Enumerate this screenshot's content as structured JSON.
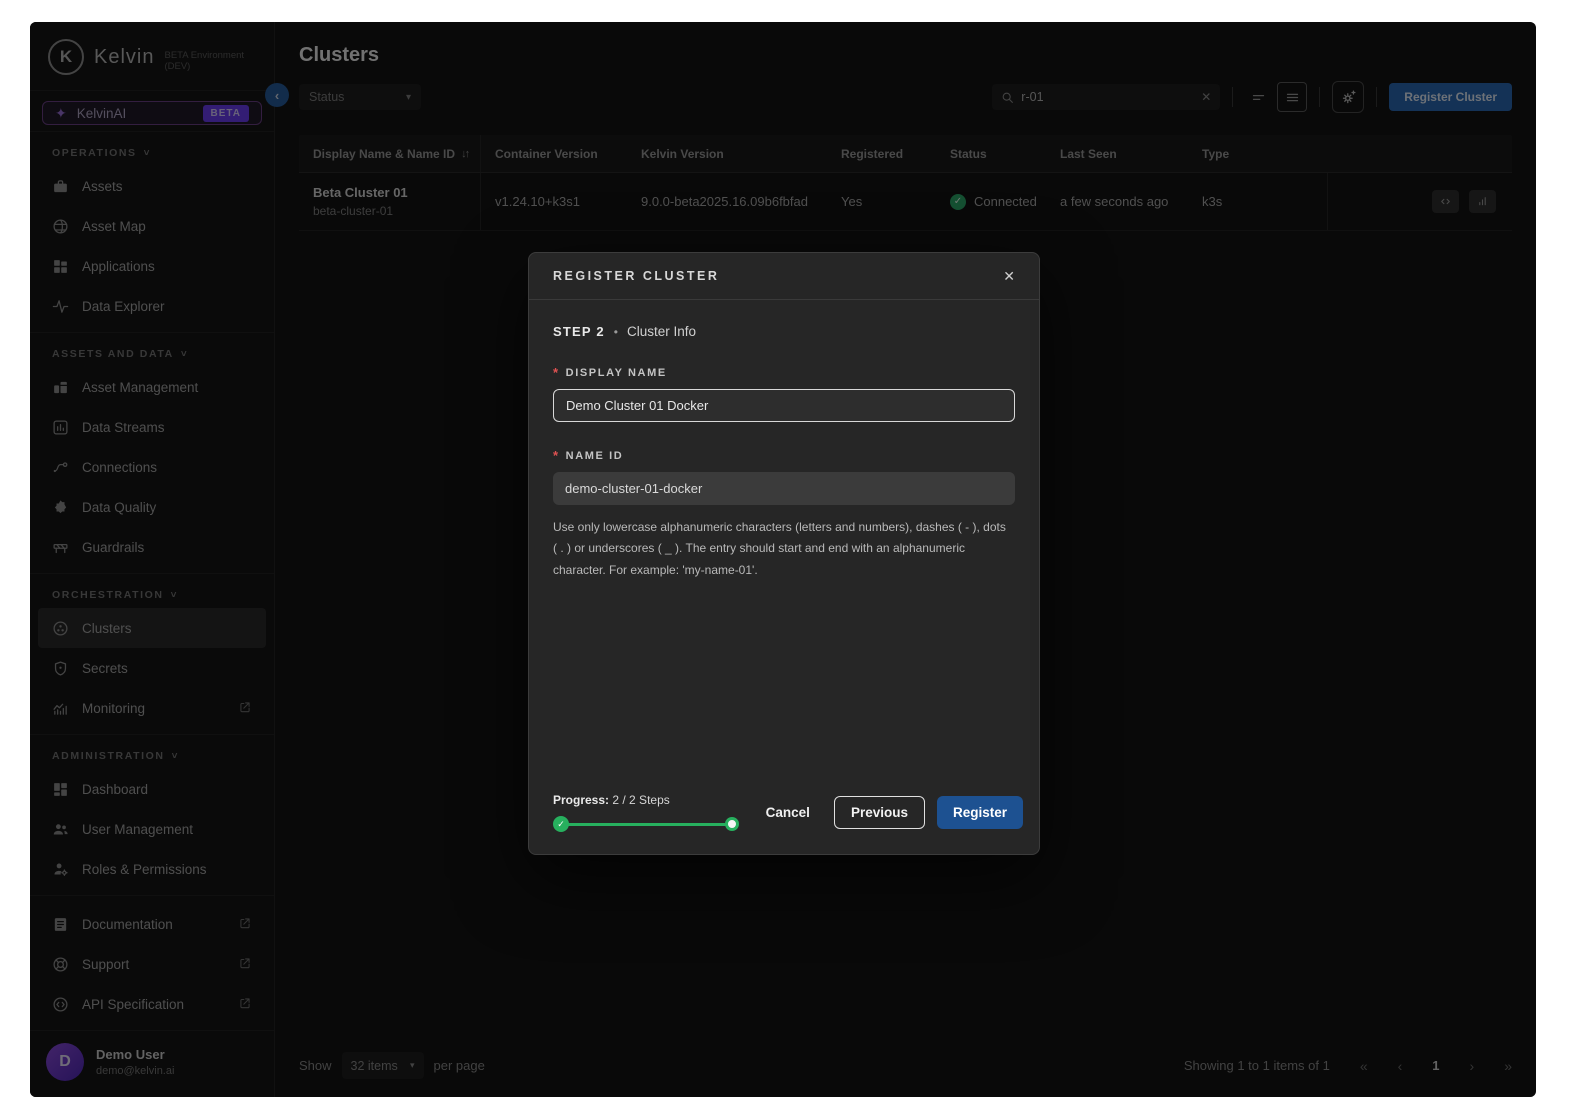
{
  "icons": {
    "sort": "↓↑",
    "chevron_down": "▾",
    "section_chevron": "˅",
    "close": "✕",
    "clear": "✕",
    "bullet": "•",
    "check": "✓",
    "first": "«",
    "prev": "‹",
    "next": "›",
    "last": "»",
    "collapse": "‹",
    "sparkle": "✦"
  },
  "colors": {
    "accent_blue": "#1d5191",
    "green": "#27b05e",
    "purple": "#6b3df2",
    "red": "#e05252"
  },
  "sidebar": {
    "logo_text": "Kelvin",
    "env_label": "BETA Environment (DEV)",
    "kelvinai": {
      "label": "KelvinAI",
      "badge": "BETA"
    },
    "sections": [
      {
        "label": "OPERATIONS",
        "items": [
          {
            "label": "Assets"
          },
          {
            "label": "Asset Map"
          },
          {
            "label": "Applications"
          },
          {
            "label": "Data Explorer"
          }
        ]
      },
      {
        "label": "ASSETS AND DATA",
        "items": [
          {
            "label": "Asset Management"
          },
          {
            "label": "Data Streams"
          },
          {
            "label": "Connections"
          },
          {
            "label": "Data Quality"
          },
          {
            "label": "Guardrails"
          }
        ]
      },
      {
        "label": "ORCHESTRATION",
        "items": [
          {
            "label": "Clusters"
          },
          {
            "label": "Secrets"
          },
          {
            "label": "Monitoring"
          }
        ]
      },
      {
        "label": "ADMINISTRATION",
        "items": [
          {
            "label": "Dashboard"
          },
          {
            "label": "User Management"
          },
          {
            "label": "Roles & Permissions"
          }
        ]
      }
    ],
    "footer_links": [
      {
        "label": "Documentation"
      },
      {
        "label": "Support"
      },
      {
        "label": "API Specification"
      }
    ],
    "user": {
      "initial": "D",
      "name": "Demo User",
      "email": "demo@kelvin.ai"
    }
  },
  "header": {
    "title": "Clusters",
    "status_filter_label": "Status",
    "search_value": "r-01",
    "register_button": "Register Cluster"
  },
  "table": {
    "columns": {
      "display_name": "Display Name & Name ID",
      "container_version": "Container Version",
      "kelvin_version": "Kelvin Version",
      "registered": "Registered",
      "status": "Status",
      "last_seen": "Last Seen",
      "type": "Type"
    },
    "row": {
      "display_name": "Beta Cluster 01",
      "name_id": "beta-cluster-01",
      "container_version": "v1.24.10+k3s1",
      "kelvin_version": "9.0.0-beta2025.16.09b6fbfad",
      "registered": "Yes",
      "status": "Connected",
      "last_seen": "a few seconds ago",
      "type": "k3s"
    }
  },
  "pagination": {
    "show_label": "Show",
    "page_size": "32 items",
    "per_page_label": "per page",
    "summary": "Showing 1 to 1 items of 1",
    "current_page": "1"
  },
  "modal": {
    "title": "REGISTER CLUSTER",
    "step_label": "STEP 2",
    "step_name": "Cluster Info",
    "required_marker": "*",
    "display_name": {
      "label": "DISPLAY NAME",
      "value": "Demo Cluster 01 Docker"
    },
    "name_id": {
      "label": "NAME ID",
      "value": "demo-cluster-01-docker",
      "help": "Use only lowercase alphanumeric characters (letters and numbers), dashes ( - ), dots ( . ) or underscores ( _ ). The entry should start and end with an alphanumeric character. For example: 'my-name-01'."
    },
    "progress_label": "Progress:",
    "progress_text": "2 / 2 Steps",
    "cancel": "Cancel",
    "previous": "Previous",
    "register": "Register"
  }
}
